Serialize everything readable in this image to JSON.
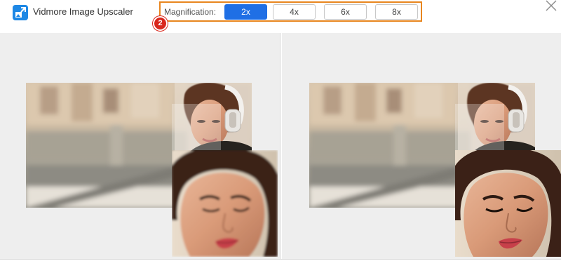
{
  "app": {
    "title": "Vidmore Image Upscaler",
    "logo_icon": "image-upscaler-logo-icon"
  },
  "magnification": {
    "label": "Magnification:",
    "options": [
      "2x",
      "4x",
      "6x",
      "8x"
    ],
    "selected": "2x",
    "highlight_color": "#e8861f",
    "active_color": "#1f6fe5"
  },
  "step_badge": {
    "number": "2",
    "color": "#d9261c"
  },
  "window": {
    "close_icon": "close-icon"
  },
  "panels": {
    "left": {
      "name": "original-image-panel"
    },
    "right": {
      "name": "upscaled-image-panel"
    }
  }
}
